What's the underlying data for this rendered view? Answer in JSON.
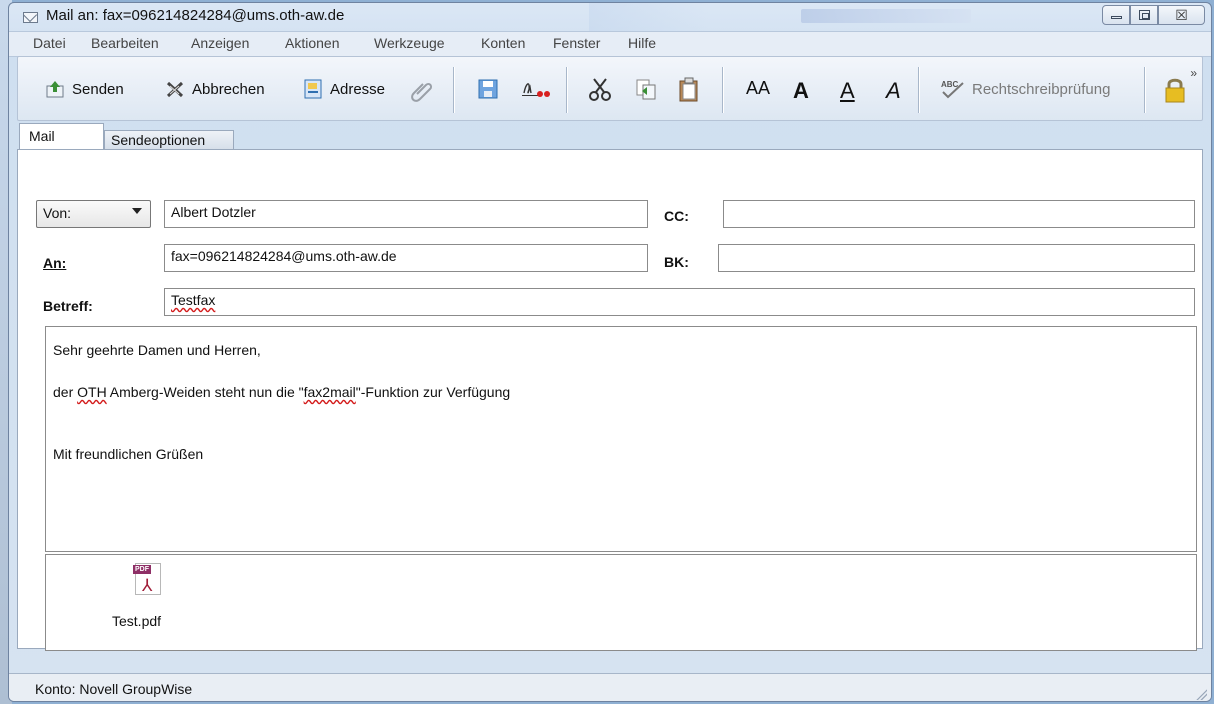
{
  "window": {
    "title": "Mail an: fax=096214824284@ums.oth-aw.de",
    "close_glyph": "☒"
  },
  "menu": {
    "items": [
      "Datei",
      "Bearbeiten",
      "Anzeigen",
      "Aktionen",
      "Werkzeuge",
      "Konten",
      "Fenster",
      "Hilfe"
    ]
  },
  "toolbar": {
    "send_label": "Senden",
    "cancel_label": "Abbrechen",
    "address_label": "Adresse",
    "spellcheck_label": "Rechtschreibprüfung",
    "font_small_label": "AA",
    "font_bold_label": "A",
    "font_underline_label": "A",
    "font_italic_label": "A",
    "more_glyph": "»"
  },
  "tabs": [
    {
      "label": "Mail"
    },
    {
      "label": "Sendeoptionen"
    }
  ],
  "form": {
    "from_label": "Von:",
    "from_value": "Albert Dotzler",
    "to_label": "An:",
    "to_value": "fax=096214824284@ums.oth-aw.de",
    "cc_label": "CC:",
    "cc_value": "",
    "bcc_label": "BK:",
    "bcc_value": "",
    "subject_label": "Betreff:",
    "subject_value": "Testfax"
  },
  "message": {
    "greeting": "Sehr geehrte Damen und Herren,",
    "body_parts": [
      "der ",
      "OTH",
      " Amberg-Weiden steht nun die \"",
      "fax2mail",
      "\"-Funktion zur Verfügung"
    ],
    "closing": "Mit freundlichen Grüßen"
  },
  "attachment": {
    "badge": "PDF",
    "name": "Test.pdf"
  },
  "status": {
    "text": "Konto: Novell GroupWise"
  },
  "colors": {
    "send_green": "#3a8f36",
    "accent_blue": "#2f6fb0",
    "lock_yellow": "#e7bd22"
  }
}
